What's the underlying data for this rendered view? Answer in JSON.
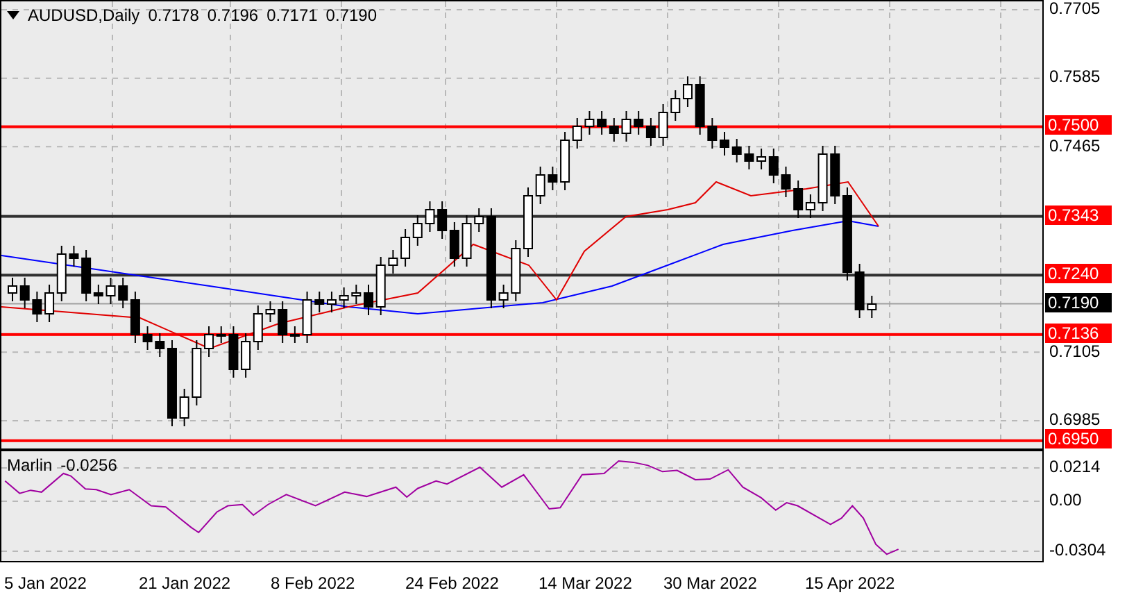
{
  "header": {
    "symbol": "AUDUSD,Daily",
    "ohlc": [
      "0.7178",
      "0.7196",
      "0.7171",
      "0.7190"
    ]
  },
  "price_axis": {
    "ticks": [
      "0.7705",
      "0.7585",
      "0.7465",
      "0.7105",
      "0.6985"
    ]
  },
  "levels": [
    {
      "label": "0.7500",
      "color": "#ff0000"
    },
    {
      "label": "0.7343",
      "color": "#303030"
    },
    {
      "label": "0.7240",
      "color": "#303030"
    },
    {
      "label": "0.7136",
      "color": "#ff0000"
    },
    {
      "label": "0.6950",
      "color": "#ff0000"
    }
  ],
  "current_price": {
    "label": "0.7190"
  },
  "indicator": {
    "name": "Marlin",
    "value": "-0.0256",
    "ticks": [
      "0.0214",
      "0.00",
      "-0.0304"
    ]
  },
  "date_axis": {
    "labels": [
      "5 Jan 2022",
      "21 Jan 2022",
      "8 Feb 2022",
      "24 Feb 2022",
      "14 Mar 2022",
      "30 Mar 2022",
      "15 Apr 2022"
    ]
  }
}
